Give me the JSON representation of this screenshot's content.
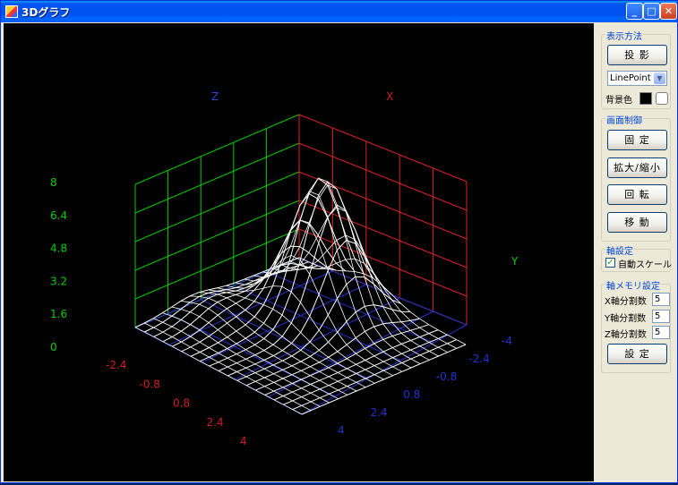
{
  "window": {
    "title": "3Dグラフ",
    "minimize": "_",
    "maximize": "□",
    "close": "✕"
  },
  "plot": {
    "axis_titles": {
      "z": "Z",
      "x": "X",
      "y": "Y"
    },
    "z_ticks": [
      "8",
      "6.4",
      "4.8",
      "3.2",
      "1.6",
      "0"
    ],
    "x_ticks": [
      "-2.4",
      "-0.8",
      "0.8",
      "2.4",
      "4"
    ],
    "y_ticks": [
      "-4",
      "-2.4",
      "-0.8",
      "0.8",
      "2.4",
      "4"
    ],
    "colors": {
      "background": "#000000",
      "zx_wall": "#00cc00",
      "xz_wall": "#dd2222",
      "floor": "#2233cc",
      "surface": "#ffffff",
      "z_label": "#00cc00",
      "x_label": "#cc2222",
      "y_label": "#2233cc"
    }
  },
  "chart_data": {
    "type": "surface",
    "surface_function": "single gaussian peak with secondary ripple",
    "z_range": [
      0,
      8
    ],
    "x_range": [
      -4,
      4
    ],
    "y_range": [
      -4,
      4
    ],
    "peak_z": 8
  },
  "panel": {
    "display": {
      "group_label": "表示方法",
      "projection_button": "投 影",
      "mode_select": "LinePoint",
      "bgcolor_label": "背景色"
    },
    "screen_control": {
      "group_label": "画面制御",
      "fix_button": "固 定",
      "zoom_button": "拡大/縮小",
      "rotate_button": "回 転",
      "move_button": "移 動"
    },
    "axis_settings": {
      "group_label": "軸設定",
      "auto_scale_label": "自動スケール",
      "auto_scale_checked": "✓"
    },
    "axis_memo": {
      "group_label": "軸メモリ設定",
      "x_div_label": "X軸分割数",
      "x_div_value": "5",
      "y_div_label": "Y軸分割数",
      "y_div_value": "5",
      "z_div_label": "Z軸分割数",
      "z_div_value": "5",
      "apply_button": "設 定"
    }
  }
}
